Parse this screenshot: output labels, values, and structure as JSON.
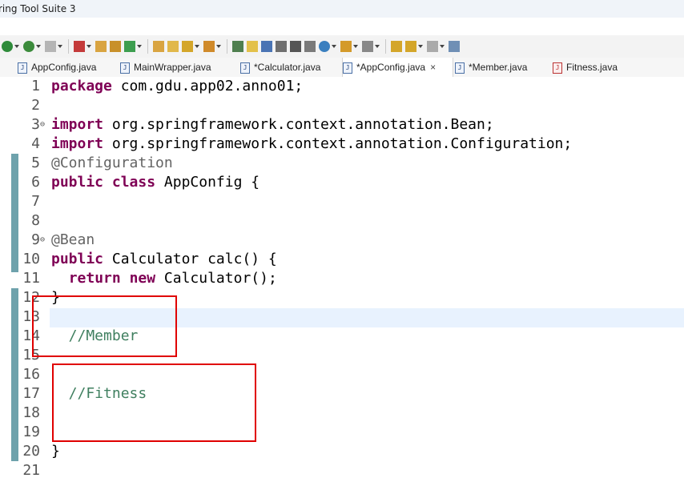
{
  "window": {
    "title": "ring Tool Suite 3"
  },
  "tabs": [
    {
      "label": "AppConfig.java",
      "active": false,
      "icon": "java-file-icon"
    },
    {
      "label": "MainWrapper.java",
      "active": false,
      "icon": "java-file-icon"
    },
    {
      "label": "*Calculator.java",
      "active": false,
      "icon": "java-file-icon"
    },
    {
      "label": "*AppConfig.java",
      "active": true,
      "icon": "java-file-icon",
      "close": "×"
    },
    {
      "label": "*Member.java",
      "active": false,
      "icon": "java-file-icon"
    },
    {
      "label": "Fitness.java",
      "active": false,
      "icon": "java-error-file-icon"
    }
  ],
  "editor": {
    "current_line": 13,
    "lines": [
      {
        "num": "1",
        "parts": [
          {
            "t": "package",
            "c": "kw"
          },
          {
            "t": " com.gdu.app02.anno01;",
            "c": ""
          }
        ]
      },
      {
        "num": "2",
        "parts": []
      },
      {
        "num": "3",
        "fold": "⊖",
        "parts": [
          {
            "t": "import",
            "c": "kw"
          },
          {
            "t": " org.springframework.context.annotation.Bean;",
            "c": ""
          }
        ]
      },
      {
        "num": "4",
        "parts": [
          {
            "t": "import",
            "c": "kw"
          },
          {
            "t": " org.springframework.context.annotation.Configuration;",
            "c": ""
          }
        ]
      },
      {
        "num": "5",
        "parts": [
          {
            "t": "@Configuration",
            "c": "ann"
          }
        ]
      },
      {
        "num": "6",
        "parts": [
          {
            "t": "public",
            "c": "kw"
          },
          {
            "t": " ",
            "c": ""
          },
          {
            "t": "class",
            "c": "kw"
          },
          {
            "t": " AppConfig {",
            "c": ""
          }
        ]
      },
      {
        "num": "7",
        "parts": []
      },
      {
        "num": "8",
        "parts": []
      },
      {
        "num": "9",
        "fold": "⊖",
        "parts": [
          {
            "t": "@Bean",
            "c": "ann"
          }
        ]
      },
      {
        "num": "10",
        "parts": [
          {
            "t": "public",
            "c": "kw"
          },
          {
            "t": " Calculator calc() {",
            "c": ""
          }
        ]
      },
      {
        "num": "11",
        "parts": [
          {
            "t": "  ",
            "c": ""
          },
          {
            "t": "return",
            "c": "kw"
          },
          {
            "t": " ",
            "c": ""
          },
          {
            "t": "new",
            "c": "kw"
          },
          {
            "t": " Calculator();",
            "c": ""
          }
        ]
      },
      {
        "num": "12",
        "parts": [
          {
            "t": "}",
            "c": ""
          }
        ]
      },
      {
        "num": "13",
        "parts": []
      },
      {
        "num": "14",
        "parts": [
          {
            "t": "  //Member",
            "c": "cmt"
          }
        ]
      },
      {
        "num": "15",
        "parts": []
      },
      {
        "num": "16",
        "parts": []
      },
      {
        "num": "17",
        "parts": [
          {
            "t": "  //Fitness",
            "c": "cmt"
          }
        ]
      },
      {
        "num": "18",
        "parts": []
      },
      {
        "num": "19",
        "parts": []
      },
      {
        "num": "20",
        "parts": [
          {
            "t": "}",
            "c": ""
          }
        ]
      },
      {
        "num": "21",
        "parts": []
      }
    ]
  },
  "toolbar_icons": [
    "run-icon",
    "chevron-down-icon",
    "debug-icon",
    "chevron-down-icon",
    "stop-icon",
    "chevron-down-icon",
    "build-icon",
    "chevron-down-icon",
    "new-java-project-icon",
    "new-package-icon",
    "new-class-icon",
    "chevron-down-icon",
    "open-type-icon",
    "open-folder-icon",
    "search-icon",
    "chevron-down-icon",
    "annotation-icon",
    "chevron-down-icon",
    "quick-fix-icon",
    "mark-occurrences-icon",
    "block-selection-icon",
    "show-whitespace-icon",
    "pilcrow-icon",
    "word-wrap-icon",
    "globe-icon",
    "chevron-down-icon",
    "next-annotation-icon",
    "chevron-down-icon",
    "prev-annotation-icon",
    "chevron-down-icon",
    "last-edit-icon",
    "back-icon",
    "chevron-down-icon",
    "forward-icon",
    "chevron-down-icon",
    "pin-editor-icon"
  ],
  "colors": {
    "keyword": "#7f0055",
    "annotation": "#646464",
    "comment": "#3f7f5f",
    "highlight": "#e00000",
    "ruler": "#6ea2ac"
  }
}
